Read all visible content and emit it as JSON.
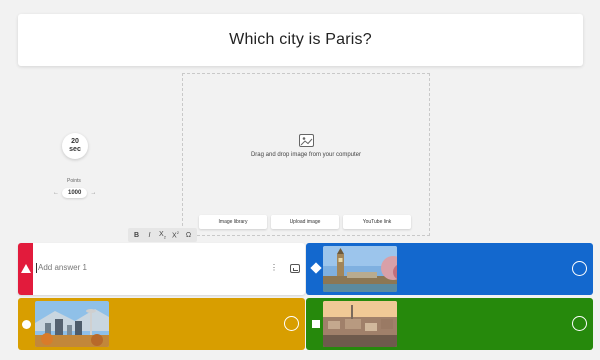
{
  "question": {
    "title": "Which city is Paris?"
  },
  "timer": {
    "value": "20",
    "unit": "sec"
  },
  "points": {
    "label": "Points",
    "value": "1000",
    "left_arrow": "←",
    "right_arrow": "→"
  },
  "media": {
    "prompt": "Drag and drop image from your computer",
    "buttons": [
      "Image library",
      "Upload image",
      "YouTube link"
    ]
  },
  "format": {
    "bold": "B",
    "italic": "I",
    "sub": "X",
    "sub_mark": "2",
    "sup": "X",
    "sup_mark": "2",
    "omega": "Ω"
  },
  "answers": [
    {
      "shape": "triangle-icon",
      "color": "#e21b3c",
      "placeholder": "Add answer 1",
      "has_image": false
    },
    {
      "shape": "diamond-icon",
      "color": "#1368ce",
      "image": "London cityscape with Big Ben",
      "has_image": true
    },
    {
      "shape": "circle-icon",
      "color": "#d89e00",
      "image": "Seattle skyline with Space Needle",
      "has_image": true
    },
    {
      "shape": "square-icon",
      "color": "#26890c",
      "image": "Paris rooftops at sunset",
      "has_image": true
    }
  ],
  "icons": {
    "kebab": "⋮"
  }
}
